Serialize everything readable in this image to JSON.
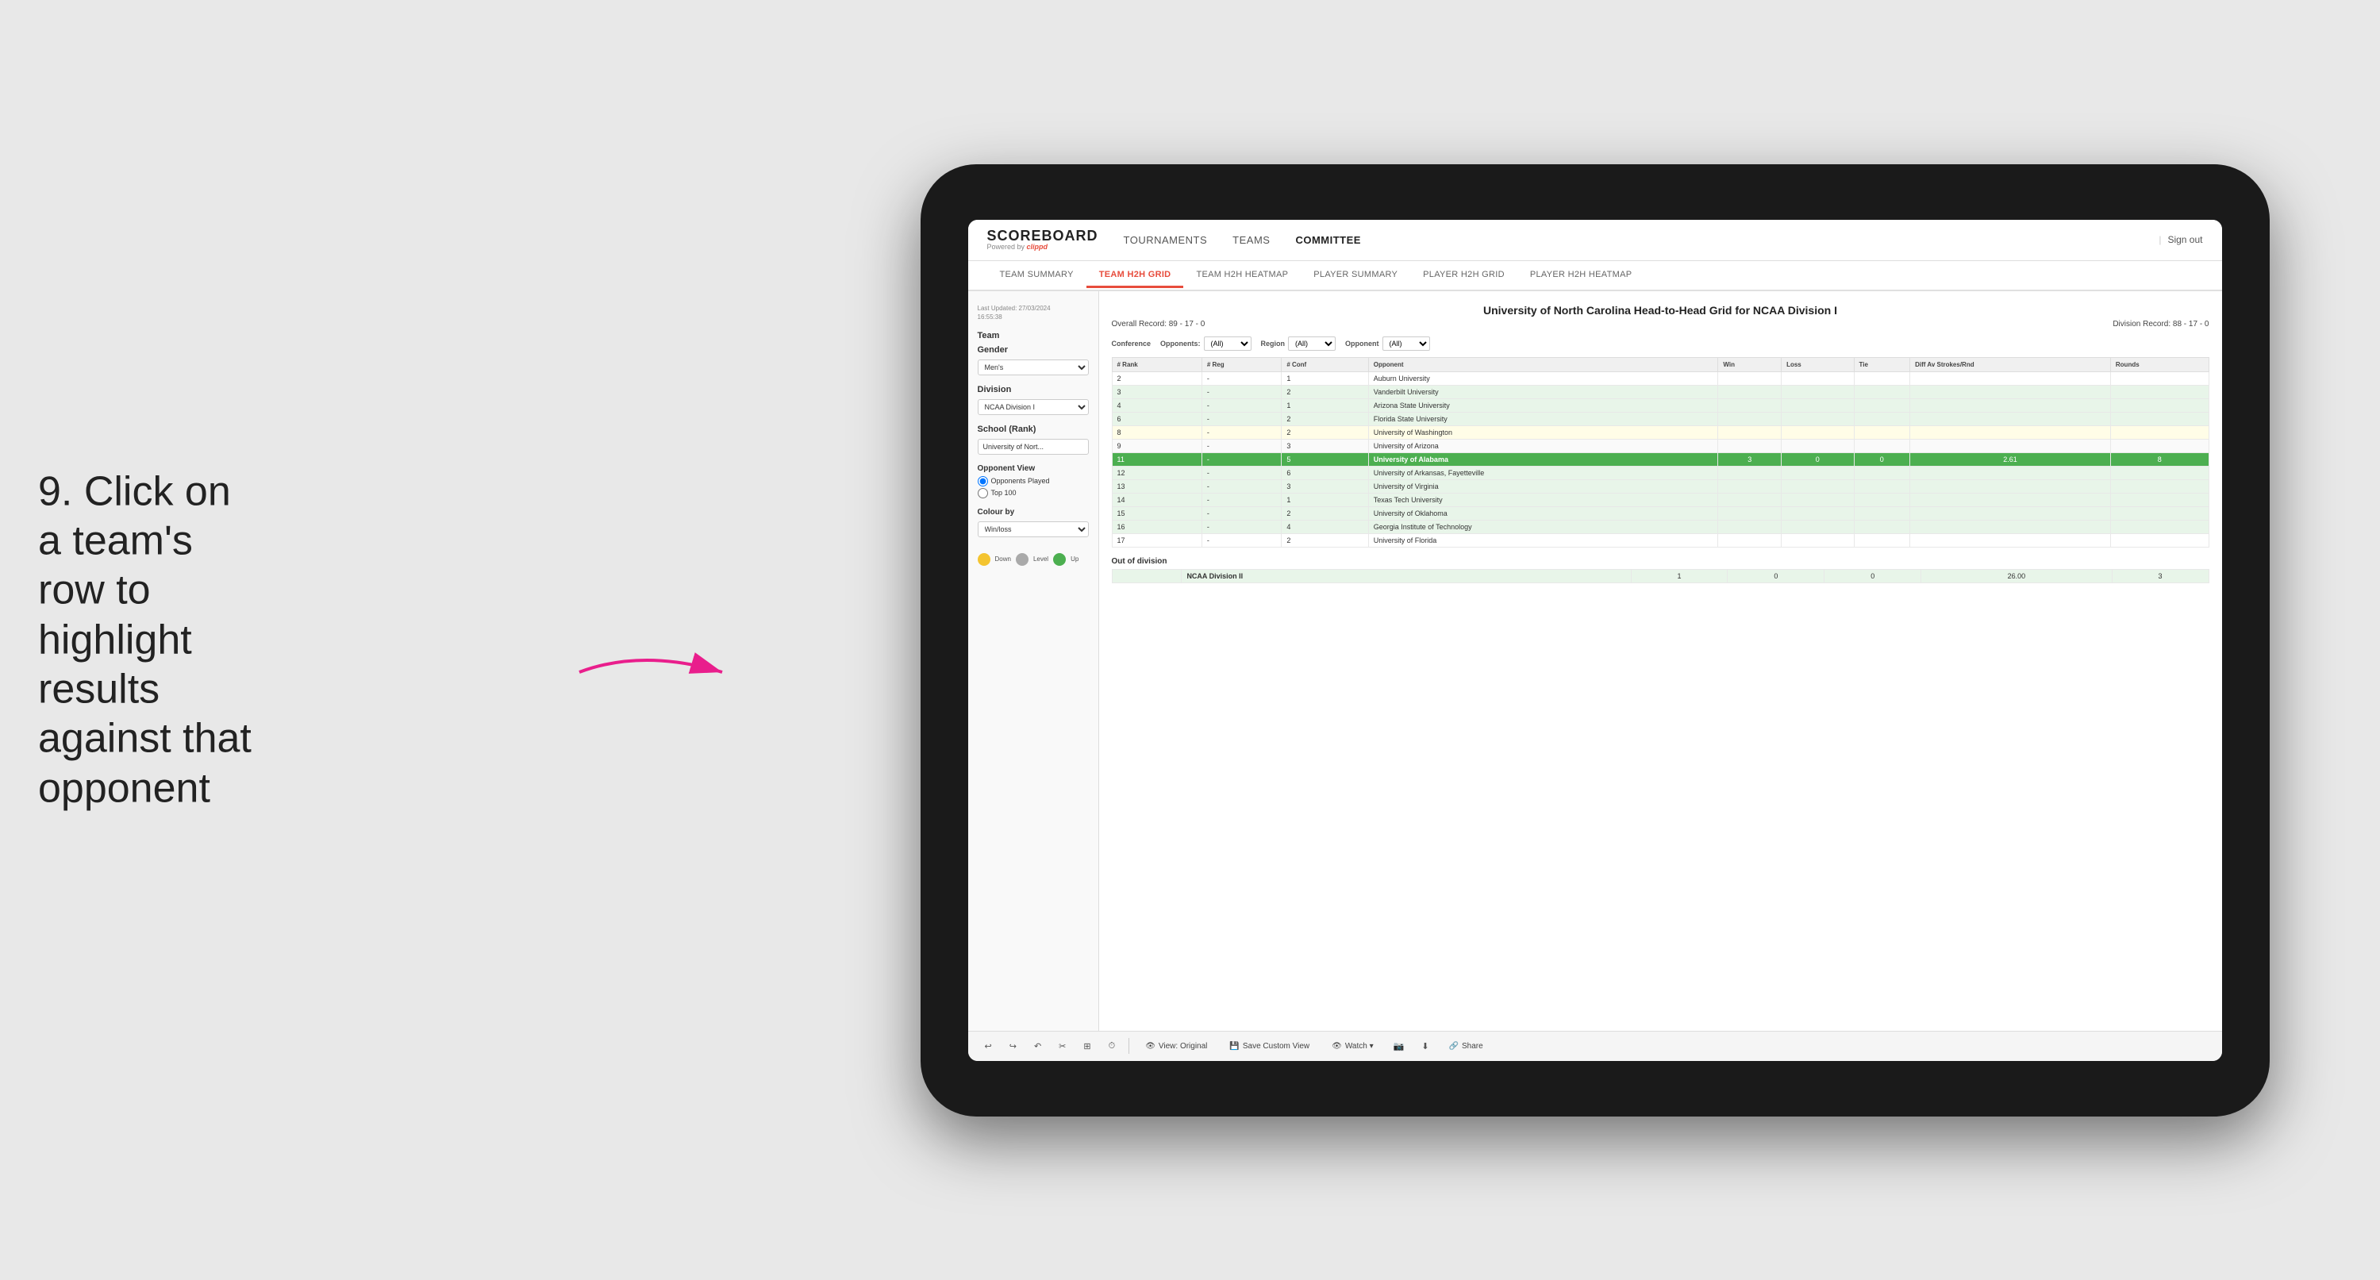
{
  "instruction": {
    "step": "9.",
    "text": "Click on a team's row to highlight results against that opponent"
  },
  "app": {
    "logo": "SCOREBOARD",
    "powered_by": "Powered by clippd",
    "sign_out": "Sign out"
  },
  "nav": {
    "items": [
      {
        "label": "TOURNAMENTS",
        "active": false
      },
      {
        "label": "TEAMS",
        "active": false
      },
      {
        "label": "COMMITTEE",
        "active": true
      }
    ]
  },
  "sub_nav": {
    "items": [
      {
        "label": "TEAM SUMMARY",
        "active": false
      },
      {
        "label": "TEAM H2H GRID",
        "active": true
      },
      {
        "label": "TEAM H2H HEATMAP",
        "active": false
      },
      {
        "label": "PLAYER SUMMARY",
        "active": false
      },
      {
        "label": "PLAYER H2H GRID",
        "active": false
      },
      {
        "label": "PLAYER H2H HEATMAP",
        "active": false
      }
    ]
  },
  "sidebar": {
    "timestamp_label": "Last Updated: 27/03/2024",
    "timestamp_time": "16:55:38",
    "team_label": "Team",
    "gender_label": "Gender",
    "gender_value": "Men's",
    "division_label": "Division",
    "division_value": "NCAA Division I",
    "school_label": "School (Rank)",
    "school_value": "University of Nort...",
    "opponent_view_label": "Opponent View",
    "radio_opponents": "Opponents Played",
    "radio_top100": "Top 100",
    "colour_by_label": "Colour by",
    "colour_by_value": "Win/loss",
    "legend": [
      {
        "color": "#f4c430",
        "label": "Down"
      },
      {
        "color": "#aaa",
        "label": "Level"
      },
      {
        "color": "#4caf50",
        "label": "Up"
      }
    ]
  },
  "grid": {
    "title": "University of North Carolina Head-to-Head Grid for NCAA Division I",
    "overall_record": "Overall Record: 89 - 17 - 0",
    "division_record": "Division Record: 88 - 17 - 0",
    "filter_opponents_label": "Opponents:",
    "filter_opponents_value": "(All)",
    "filter_region_label": "Region",
    "filter_region_value": "(All)",
    "filter_opponent_label": "Opponent",
    "filter_opponent_value": "(All)",
    "columns": [
      "# Rank",
      "# Reg",
      "# Conf",
      "Opponent",
      "Win",
      "Loss",
      "Tie",
      "Diff Av Strokes/Rnd",
      "Rounds"
    ],
    "rows": [
      {
        "rank": "2",
        "reg": "-",
        "conf": "1",
        "opponent": "Auburn University",
        "win": "",
        "loss": "",
        "tie": "",
        "diff": "",
        "rounds": "",
        "style": "normal"
      },
      {
        "rank": "3",
        "reg": "-",
        "conf": "2",
        "opponent": "Vanderbilt University",
        "win": "",
        "loss": "",
        "tie": "",
        "diff": "",
        "rounds": "",
        "style": "light-green"
      },
      {
        "rank": "4",
        "reg": "-",
        "conf": "1",
        "opponent": "Arizona State University",
        "win": "",
        "loss": "",
        "tie": "",
        "diff": "",
        "rounds": "",
        "style": "light-green"
      },
      {
        "rank": "6",
        "reg": "-",
        "conf": "2",
        "opponent": "Florida State University",
        "win": "",
        "loss": "",
        "tie": "",
        "diff": "",
        "rounds": "",
        "style": "light-green"
      },
      {
        "rank": "8",
        "reg": "-",
        "conf": "2",
        "opponent": "University of Washington",
        "win": "",
        "loss": "",
        "tie": "",
        "diff": "",
        "rounds": "",
        "style": "light-yellow"
      },
      {
        "rank": "9",
        "reg": "-",
        "conf": "3",
        "opponent": "University of Arizona",
        "win": "",
        "loss": "",
        "tie": "",
        "diff": "",
        "rounds": "",
        "style": "normal"
      },
      {
        "rank": "11",
        "reg": "-",
        "conf": "5",
        "opponent": "University of Alabama",
        "win": "3",
        "loss": "0",
        "tie": "0",
        "diff": "2.61",
        "rounds": "8",
        "style": "highlighted"
      },
      {
        "rank": "12",
        "reg": "-",
        "conf": "6",
        "opponent": "University of Arkansas, Fayetteville",
        "win": "",
        "loss": "",
        "tie": "",
        "diff": "",
        "rounds": "",
        "style": "light-green"
      },
      {
        "rank": "13",
        "reg": "-",
        "conf": "3",
        "opponent": "University of Virginia",
        "win": "",
        "loss": "",
        "tie": "",
        "diff": "",
        "rounds": "",
        "style": "light-green"
      },
      {
        "rank": "14",
        "reg": "-",
        "conf": "1",
        "opponent": "Texas Tech University",
        "win": "",
        "loss": "",
        "tie": "",
        "diff": "",
        "rounds": "",
        "style": "light-green"
      },
      {
        "rank": "15",
        "reg": "-",
        "conf": "2",
        "opponent": "University of Oklahoma",
        "win": "",
        "loss": "",
        "tie": "",
        "diff": "",
        "rounds": "",
        "style": "light-green"
      },
      {
        "rank": "16",
        "reg": "-",
        "conf": "4",
        "opponent": "Georgia Institute of Technology",
        "win": "",
        "loss": "",
        "tie": "",
        "diff": "",
        "rounds": "",
        "style": "light-green"
      },
      {
        "rank": "17",
        "reg": "-",
        "conf": "2",
        "opponent": "University of Florida",
        "win": "",
        "loss": "",
        "tie": "",
        "diff": "",
        "rounds": "",
        "style": "normal"
      }
    ],
    "out_of_division_label": "Out of division",
    "out_of_division_rows": [
      {
        "opponent": "NCAA Division II",
        "win": "1",
        "loss": "0",
        "tie": "0",
        "diff": "26.00",
        "rounds": "3",
        "style": "out-div"
      }
    ]
  },
  "toolbar": {
    "undo_label": "↩",
    "redo_label": "↪",
    "view_label": "View: Original",
    "save_label": "Save Custom View",
    "watch_label": "Watch ▾",
    "share_label": "Share"
  }
}
